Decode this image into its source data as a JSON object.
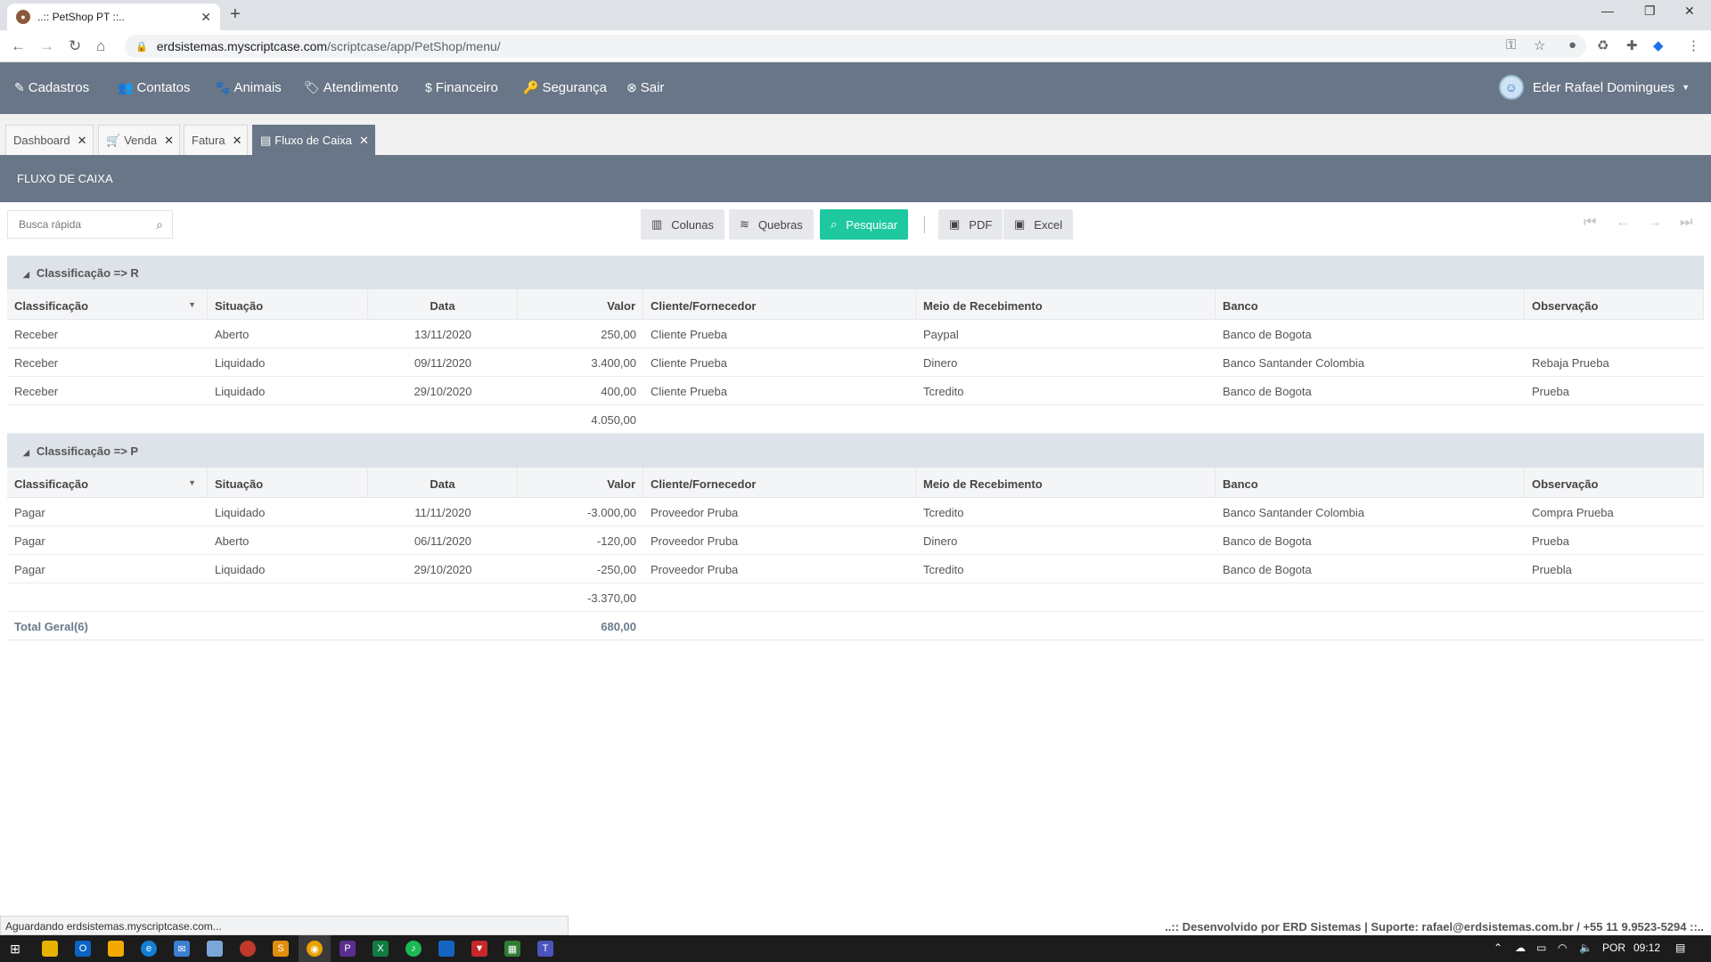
{
  "browser": {
    "tab_title": "..:: PetShop PT ::..",
    "url_host": "erdsistemas.myscriptcase.com",
    "url_path": "/scriptcase/app/PetShop/menu/"
  },
  "menu": {
    "items": [
      "Cadastros",
      "Contatos",
      "Animais",
      "Atendimento",
      "Financeiro",
      "Segurança",
      "Sair"
    ],
    "user": "Eder Rafael Domingues"
  },
  "app_tabs": [
    "Dashboard",
    "Venda",
    "Fatura",
    "Fluxo de Caixa"
  ],
  "section_title": "FLUXO DE CAIXA",
  "toolbar": {
    "search_placeholder": "Busca rápida",
    "colunas": "Colunas",
    "quebras": "Quebras",
    "pesquisar": "Pesquisar",
    "pdf": "PDF",
    "excel": "Excel"
  },
  "columns": [
    "Classificação",
    "Situação",
    "Data",
    "Valor",
    "Cliente/Fornecedor",
    "Meio de Recebimento",
    "Banco",
    "Observação"
  ],
  "groups": [
    {
      "title": "Classificação => R",
      "rows": [
        [
          "Receber",
          "Aberto",
          "13/11/2020",
          "250,00",
          "Cliente Prueba",
          "Paypal",
          "Banco de Bogota",
          ""
        ],
        [
          "Receber",
          "Liquidado",
          "09/11/2020",
          "3.400,00",
          "Cliente Prueba",
          "Dinero",
          "Banco Santander Colombia",
          "Rebaja Prueba"
        ],
        [
          "Receber",
          "Liquidado",
          "29/10/2020",
          "400,00",
          "Cliente Prueba",
          "Tcredito",
          "Banco de Bogota",
          "Prueba"
        ]
      ],
      "subtotal": "4.050,00"
    },
    {
      "title": "Classificação => P",
      "rows": [
        [
          "Pagar",
          "Liquidado",
          "11/11/2020",
          "-3.000,00",
          "Proveedor Pruba",
          "Tcredito",
          "Banco Santander Colombia",
          "Compra Prueba"
        ],
        [
          "Pagar",
          "Aberto",
          "06/11/2020",
          "-120,00",
          "Proveedor Pruba",
          "Dinero",
          "Banco de Bogota",
          "Prueba"
        ],
        [
          "Pagar",
          "Liquidado",
          "29/10/2020",
          "-250,00",
          "Proveedor Pruba",
          "Tcredito",
          "Banco de Bogota",
          "Pruebla"
        ]
      ],
      "subtotal": "-3.370,00"
    }
  ],
  "total": {
    "label": "Total Geral(6)",
    "value": "680,00"
  },
  "status_text": "Aguardando erdsistemas.myscriptcase.com...",
  "footer_credit": "..:: Desenvolvido por ERD Sistemas | Suporte: rafael@erdsistemas.com.br / +55 11 9.9523-5294 ::..",
  "taskbar": {
    "lang": "POR",
    "time": "09:12"
  }
}
